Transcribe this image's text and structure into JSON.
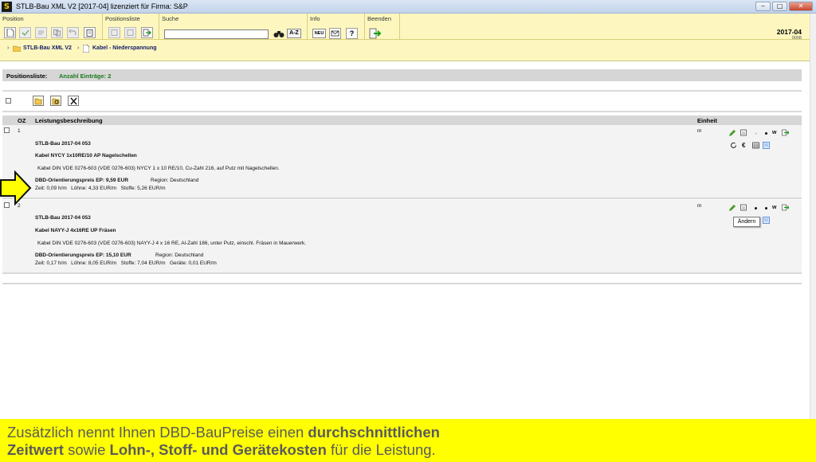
{
  "window": {
    "title": "STLB-Bau XML V2 [2017-04] lizenziert für Firma: S&P",
    "app_icon": "S",
    "controls": {
      "minimize": "‒",
      "maximize": "□",
      "close": "✕"
    }
  },
  "ribbon": {
    "groups": [
      {
        "label": "Position"
      },
      {
        "label": "Positionsliste"
      },
      {
        "label": "Suche"
      },
      {
        "label": "Info"
      },
      {
        "label": "Beenden"
      }
    ],
    "search": {
      "value": "",
      "placeholder": ""
    },
    "az_label": "A-Z",
    "neu_label": "NEU",
    "help_label": "?",
    "version": "2017-04",
    "subversion": "0008"
  },
  "breadcrumb": {
    "items": [
      "STLB-Bau XML V2",
      "Kabel - Niederspannung"
    ]
  },
  "list": {
    "label": "Positionsliste:",
    "count": "Anzahl Einträge: 2",
    "columns": {
      "oz": "OZ",
      "desc": "Leistungsbeschreibung",
      "unit": "Einheit"
    },
    "rows": [
      {
        "oz": "1",
        "unit": "m",
        "source": "STLB-Bau 2017-04 053",
        "short": "Kabel NYCY 1x10RE/10 AP Nagelschellen",
        "long": "Kabel DIN VDE 0276-603 (VDE 0276-603) NYCY 1 x 10 RE/10, Cu-Zahl 216, auf Putz mit Nagelschellen.",
        "price": "DBD-Orientierungspreis EP: 9,59 EUR",
        "region": "Region: Deutschland",
        "costs": "Zeit: 0,09 h/m   Löhne: 4,33 EUR/m   Stoffe: 5,26 EUR/m"
      },
      {
        "oz": "2",
        "unit": "m",
        "source": "STLB-Bau 2017-04 053",
        "short": "Kabel NAYY-J 4x16RE UP Fräsen",
        "long": "Kabel DIN VDE 0276-603 (VDE 0276-603) NAYY-J 4 x 16 RE, Al-Zahl 186, unter Putz, einschl. Fräsen in Mauerwerk.",
        "price": "DBD-Orientierungspreis EP: 15,10 EUR",
        "region": "Region: Deutschland",
        "costs": "Zeit: 0,17 h/m   Löhne: 8,05 EUR/m   Stoffe: 7,04 EUR/m   Geräte: 0,01 EUR/m"
      }
    ],
    "row_icon_w": "w",
    "row_icon_euro": "€",
    "tooltip": "Ändern"
  },
  "caption": {
    "l1_a": "Zusätzlich nennt Ihnen DBD-BauPreise einen ",
    "l1_b": "durchschnittlichen",
    "l2_a": "Zeitwert",
    "l2_b": " sowie ",
    "l2_c": "Lohn-, Stoff- und Gerätekosten",
    "l2_d": " für die Leistung."
  },
  "colors": {
    "ribbon": "#fdf7bf",
    "caption_bg": "#ffff00",
    "accent_green": "#1c7a1c",
    "link": "#111a66"
  }
}
